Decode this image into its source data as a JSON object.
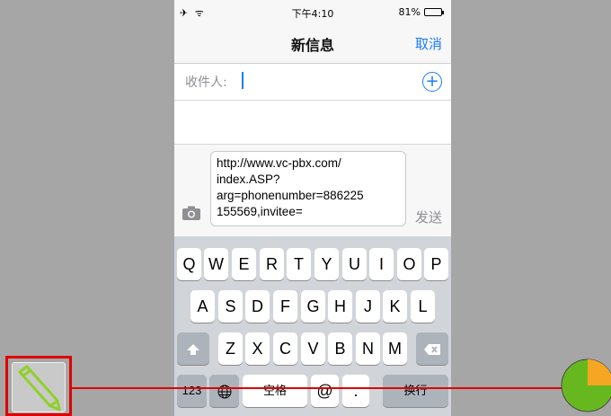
{
  "status_bar": {
    "left_icons": "✈ ᯤ",
    "time": "下午4:10",
    "battery": "81%"
  },
  "nav": {
    "title": "新信息",
    "cancel": "取消"
  },
  "recipient": {
    "label": "收件人:"
  },
  "compose": {
    "text": "http://www.vc-pbx.com/\nindex.ASP?\narg=phonenumber=886225\n155569,invitee=",
    "send": "发送"
  },
  "keyboard": {
    "row1": [
      "Q",
      "W",
      "E",
      "R",
      "T",
      "Y",
      "U",
      "I",
      "O",
      "P"
    ],
    "row2": [
      "A",
      "S",
      "D",
      "F",
      "G",
      "H",
      "J",
      "K",
      "L"
    ],
    "row3": [
      "Z",
      "X",
      "C",
      "V",
      "B",
      "N",
      "M"
    ],
    "row4": {
      "numbers": "123",
      "space": "空格",
      "at": "@",
      "dot": ".",
      "return": "换行"
    }
  },
  "colors": {
    "accent": "#1a7cf5",
    "annotation": "#e00000",
    "pie_green": "#66b81e",
    "pie_orange": "#f5a623"
  }
}
